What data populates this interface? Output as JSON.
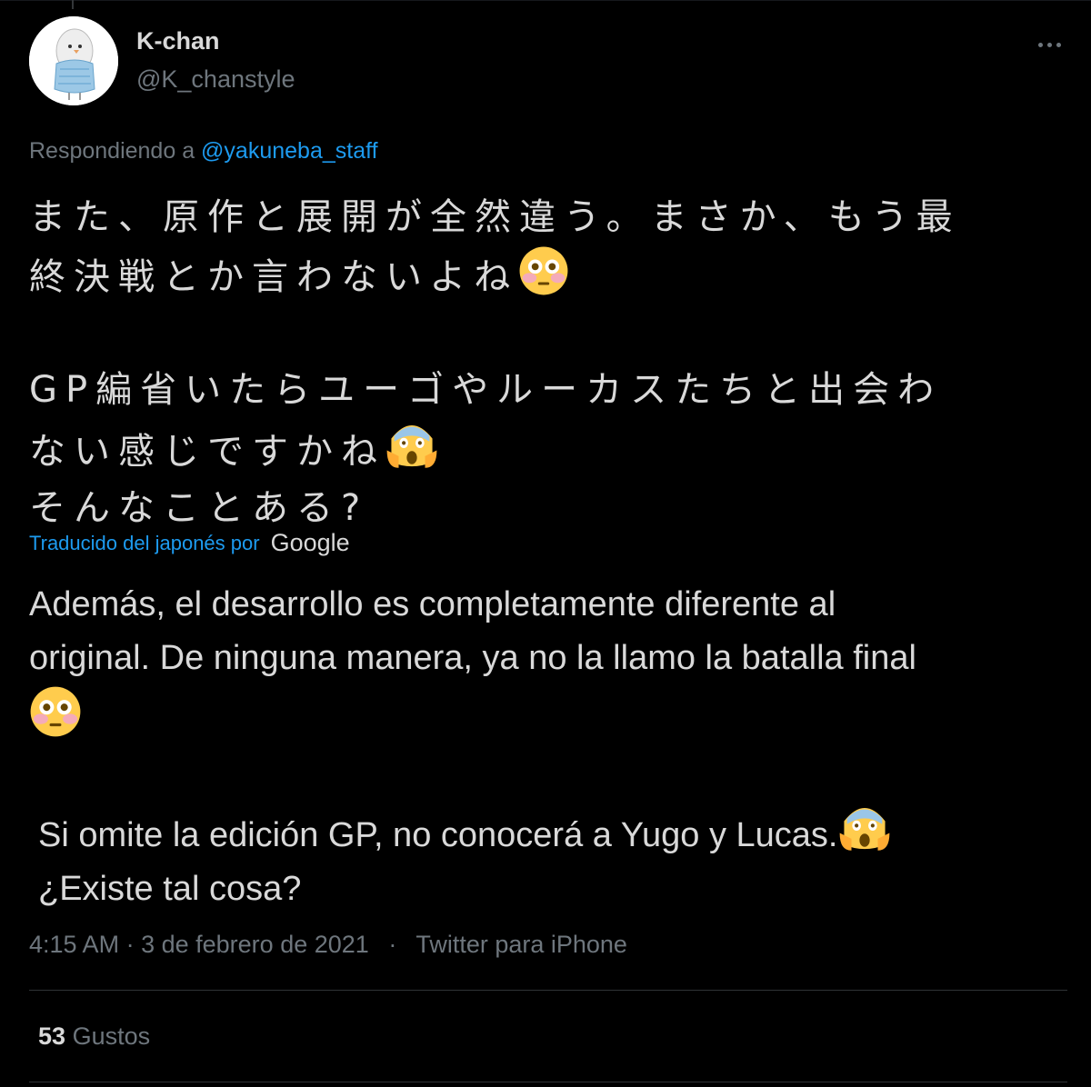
{
  "tweet": {
    "author": {
      "display_name": "K-chan",
      "handle": "@K_chanstyle"
    },
    "more_icon": "more-horizontal-icon",
    "replying_prefix": "Respondiendo a",
    "replying_to": "@yakuneba_staff",
    "original_text": {
      "p1_line1": "また、原作と展開が全然違う。まさか、もう最",
      "p1_line2": "終決戦とか言わないよね",
      "p2_line1": "GP編省いたらユーゴやルーカスたちと出会わ",
      "p2_line2": "ない感じですかね",
      "p2_line3": "そんなことある?"
    },
    "translation": {
      "label": "Traducido del japonés por",
      "provider": "Google",
      "p1_line1": "Además, el desarrollo es completamente diferente al",
      "p1_line2": "original. De ninguna manera, ya no la llamo la batalla final",
      "p2_line1": "Si omite la edición GP, no conocerá a Yugo y Lucas.",
      "p2_line2": "¿Existe tal cosa?"
    },
    "emojis": {
      "flushed": "flushed-face-emoji",
      "scream": "screaming-face-emoji"
    },
    "time": "4:15 AM",
    "date": "3 de febrero de 2021",
    "separator": "·",
    "source": "Twitter para iPhone",
    "likes_count": "53",
    "likes_label": "Gustos"
  },
  "colors": {
    "background": "#000000",
    "text": "#d9d9d9",
    "muted": "#6e767d",
    "link": "#1d9bf0"
  }
}
